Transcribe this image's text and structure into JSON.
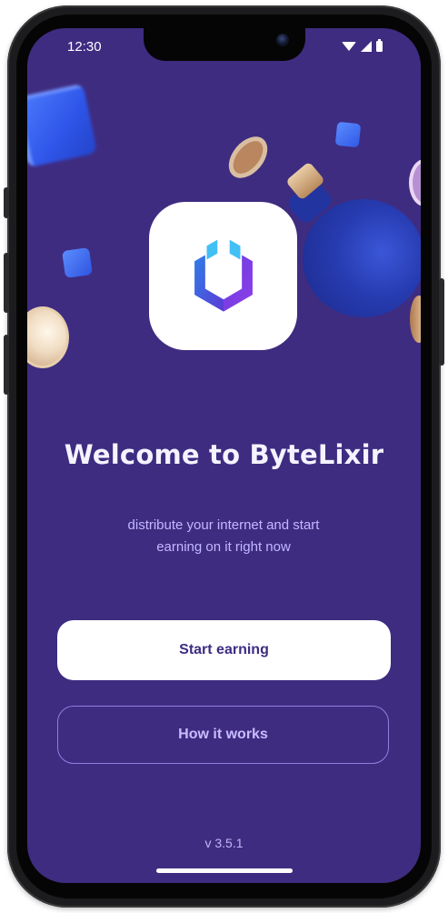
{
  "status_bar": {
    "time": "12:30",
    "icons": [
      "wifi-icon",
      "signal-icon",
      "battery-icon"
    ]
  },
  "app": {
    "logo_icon": "bytelixir-logo-icon",
    "title": "Welcome to ByteLixir",
    "subtitle_line1": "distribute your internet and start",
    "subtitle_line2": "earning on it right now",
    "primary_button": "Start earning",
    "secondary_button": "How it works",
    "version": "v 3.5.1"
  },
  "colors": {
    "background": "#3e2c81",
    "primary_button_bg": "#ffffff",
    "primary_button_text": "#3e2c81",
    "secondary_button_border": "#8f80df",
    "logo_blue": "#3b9cf0",
    "logo_purple": "#7a3fe0"
  }
}
